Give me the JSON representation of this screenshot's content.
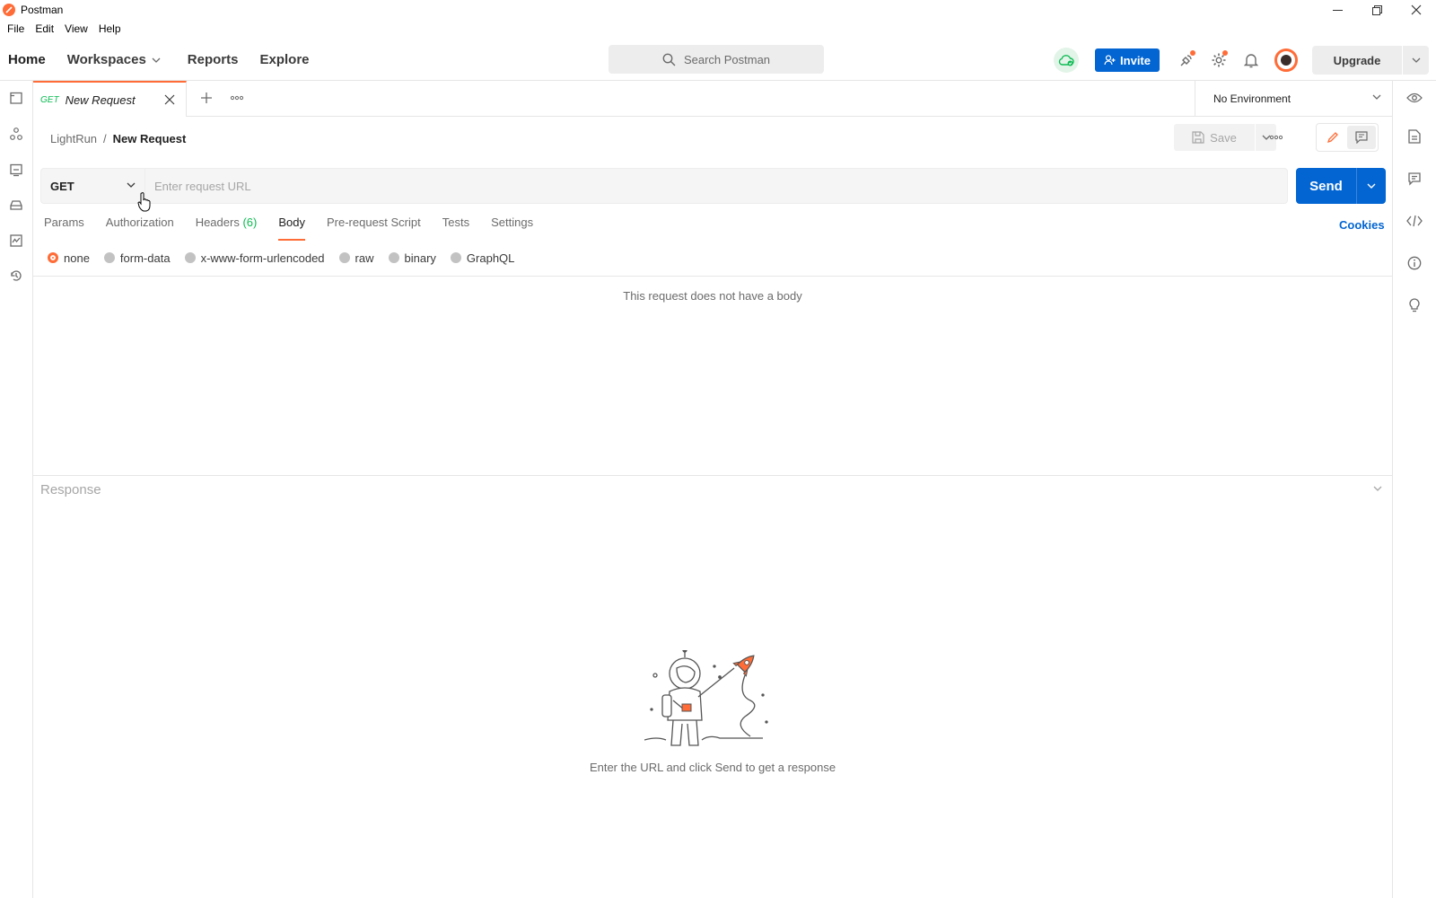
{
  "window": {
    "title": "Postman"
  },
  "menu": [
    "File",
    "Edit",
    "View",
    "Help"
  ],
  "header": {
    "nav": {
      "home": "Home",
      "workspaces": "Workspaces",
      "reports": "Reports",
      "explore": "Explore"
    },
    "search_placeholder": "Search Postman",
    "invite_label": "Invite",
    "upgrade_label": "Upgrade"
  },
  "tabs": [
    {
      "method": "GET",
      "title": "New Request"
    }
  ],
  "environment": {
    "selected": "No Environment"
  },
  "request": {
    "breadcrumb": {
      "collection": "LightRun",
      "separator": "/",
      "name": "New Request"
    },
    "save_label": "Save",
    "method": "GET",
    "url_placeholder": "Enter request URL",
    "send_label": "Send",
    "tabs": {
      "params": "Params",
      "authorization": "Authorization",
      "headers": "Headers",
      "headers_count": "(6)",
      "body": "Body",
      "pre_request": "Pre-request Script",
      "tests": "Tests",
      "settings": "Settings"
    },
    "cookies_label": "Cookies",
    "body_types": {
      "none": "none",
      "form_data": "form-data",
      "urlencoded": "x-www-form-urlencoded",
      "raw": "raw",
      "binary": "binary",
      "graphql": "GraphQL"
    },
    "body_selected": "none",
    "no_body_text": "This request does not have a body"
  },
  "response": {
    "title": "Response",
    "empty_hint": "Enter the URL and click Send to get a response"
  },
  "colors": {
    "accent": "#ff6c37",
    "primary": "#0265d2",
    "get_method": "#0cbb52"
  }
}
